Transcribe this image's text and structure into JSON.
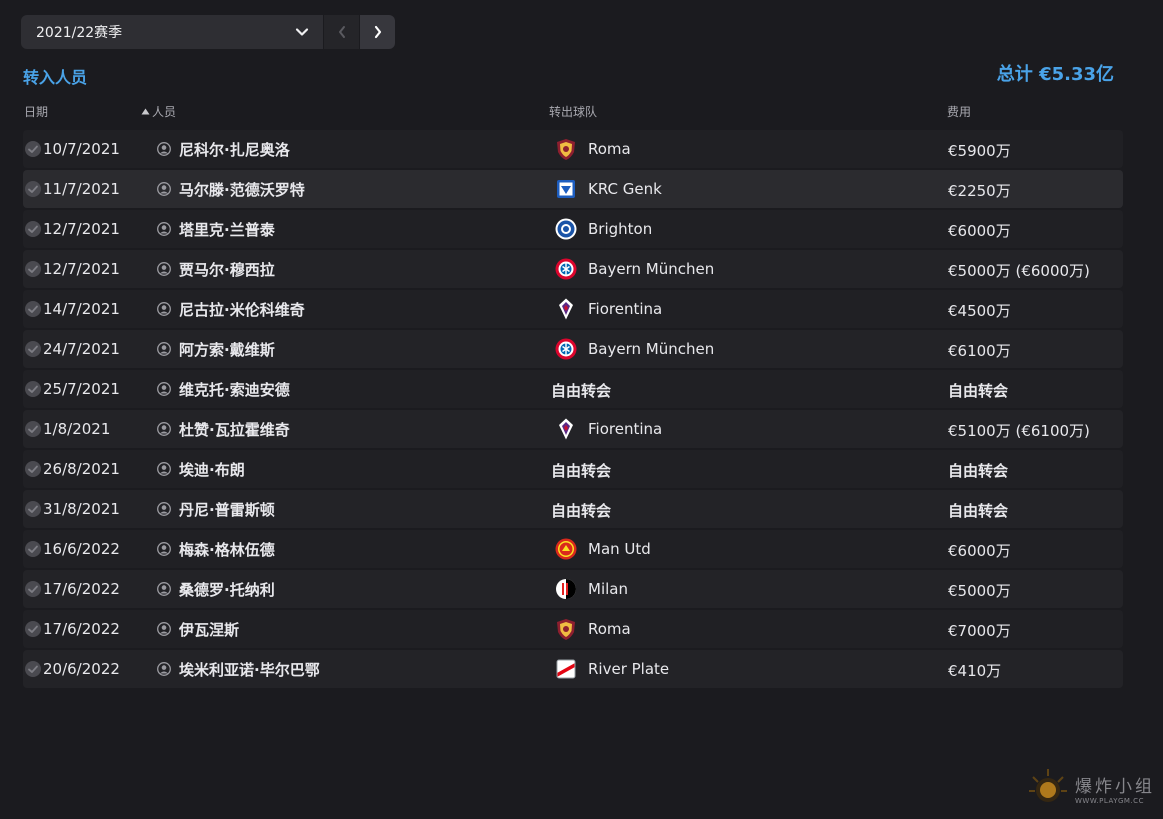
{
  "season": {
    "label": "2021/22赛季"
  },
  "section_title": "转入人员",
  "total": "总计 €5.33亿",
  "columns": {
    "date": "日期",
    "person": "人员",
    "from_club": "转出球队",
    "fee": "费用"
  },
  "transfers": [
    {
      "date": "10/7/2021",
      "name": "尼科尔·扎尼奥洛",
      "club": "Roma",
      "crest": "roma",
      "fee": "€5900万"
    },
    {
      "date": "11/7/2021",
      "name": "马尔滕·范德沃罗特",
      "club": "KRC Genk",
      "crest": "genk",
      "fee": "€2250万"
    },
    {
      "date": "12/7/2021",
      "name": "塔里克·兰普泰",
      "club": "Brighton",
      "crest": "brighton",
      "fee": "€6000万"
    },
    {
      "date": "12/7/2021",
      "name": "贾马尔·穆西拉",
      "club": "Bayern München",
      "crest": "bayern",
      "fee": "€5000万 (€6000万)"
    },
    {
      "date": "14/7/2021",
      "name": "尼古拉·米伦科维奇",
      "club": "Fiorentina",
      "crest": "fiorentina",
      "fee": "€4500万"
    },
    {
      "date": "24/7/2021",
      "name": "阿方索·戴维斯",
      "club": "Bayern München",
      "crest": "bayern",
      "fee": "€6100万"
    },
    {
      "date": "25/7/2021",
      "name": "维克托·索迪安德",
      "club": "自由转会",
      "crest": "",
      "fee": "自由转会"
    },
    {
      "date": "1/8/2021",
      "name": "杜赞·瓦拉霍维奇",
      "club": "Fiorentina",
      "crest": "fiorentina",
      "fee": "€5100万 (€6100万)"
    },
    {
      "date": "26/8/2021",
      "name": "埃迪·布朗",
      "club": "自由转会",
      "crest": "",
      "fee": "自由转会"
    },
    {
      "date": "31/8/2021",
      "name": "丹尼·普雷斯顿",
      "club": "自由转会",
      "crest": "",
      "fee": "自由转会"
    },
    {
      "date": "16/6/2022",
      "name": "梅森·格林伍德",
      "club": "Man Utd",
      "crest": "manutd",
      "fee": "€6000万"
    },
    {
      "date": "17/6/2022",
      "name": "桑德罗·托纳利",
      "club": "Milan",
      "crest": "milan",
      "fee": "€5000万"
    },
    {
      "date": "17/6/2022",
      "name": "伊瓦涅斯",
      "club": "Roma",
      "crest": "roma",
      "fee": "€7000万"
    },
    {
      "date": "20/6/2022",
      "name": "埃米利亚诺·毕尔巴鄂",
      "club": "River Plate",
      "crest": "river",
      "fee": "€410万"
    }
  ],
  "watermark": {
    "text": "爆炸小组",
    "url": "WWW.PLAYGM.CC"
  },
  "colors": {
    "accent": "#4aa3e8",
    "background": "#1b1b1f",
    "row": "#202024",
    "row_highlight": "#2b2b2f"
  }
}
